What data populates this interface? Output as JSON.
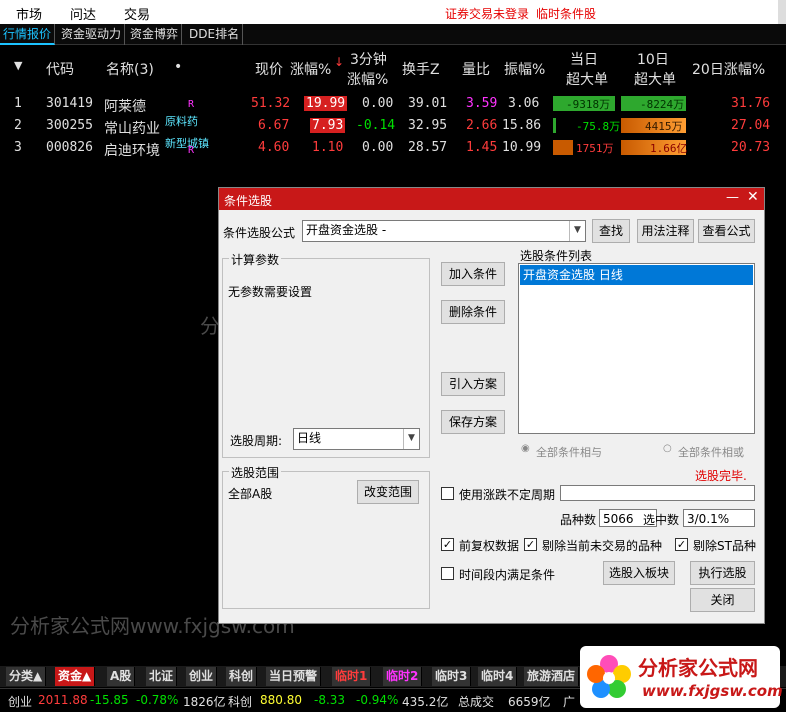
{
  "menu": {
    "items": [
      "市场",
      "问达",
      "交易"
    ],
    "alerts": [
      "证券交易未登录",
      "临时条件股"
    ]
  },
  "tabs": [
    "行情报价",
    "资金驱动力",
    "资金博弈",
    "DDE排名"
  ],
  "table": {
    "headers": {
      "code": "代码",
      "name": "名称(3)",
      "dot": "•",
      "price": "现价",
      "change": "涨幅%",
      "change3a": "3分钟",
      "change3b": "涨幅%",
      "turnover": "换手Z",
      "volratio": "量比",
      "amplitude": "振幅%",
      "bigtoday_a": "当日",
      "bigtoday_b": "超大单",
      "big10_a": "10日",
      "big10_b": "超大单",
      "change20": "20日涨幅%"
    },
    "rows": [
      {
        "idx": "1",
        "code": "301419",
        "name": "阿莱德",
        "tag": "R",
        "tag2": "",
        "price": "51.32",
        "change": "19.99",
        "change3": "0.00",
        "turnover": "39.01",
        "volratio": "3.59",
        "amplitude": "3.06",
        "bigtoday": "-9318万",
        "big10": "-8224万",
        "change20": "31.76"
      },
      {
        "idx": "2",
        "code": "300255",
        "name": "常山药业",
        "tag": "",
        "tag2": "原料药",
        "price": "6.67",
        "change": "7.93",
        "change3": "-0.14",
        "turnover": "32.95",
        "volratio": "2.66",
        "amplitude": "15.86",
        "bigtoday": "-75.8万",
        "big10": "4415万",
        "change20": "27.04"
      },
      {
        "idx": "3",
        "code": "000826",
        "name": "启迪环境",
        "tag": "R",
        "tag2": "新型城镇",
        "price": "4.60",
        "change": "1.10",
        "change3": "0.00",
        "turnover": "28.57",
        "volratio": "1.45",
        "amplitude": "10.99",
        "bigtoday": "1751万",
        "big10": "1.66亿",
        "change20": "20.73"
      }
    ]
  },
  "dialog": {
    "title": "条件选股",
    "formula_label": "条件选股公式",
    "formula_value": "开盘资金选股 -",
    "btn_find": "查找",
    "btn_usage": "用法注释",
    "btn_view": "查看公式",
    "params_title": "计算参数",
    "params_text": "无参数需要设置",
    "btn_add": "加入条件",
    "btn_delete": "删除条件",
    "btn_import": "引入方案",
    "btn_save": "保存方案",
    "cond_list_title": "选股条件列表",
    "cond_item": "开盘资金选股  日线",
    "period_label": "选股周期:",
    "period_value": "日线",
    "radio_all": "全部条件相与",
    "radio_or": "全部条件相或",
    "done_text": "选股完毕.",
    "scope_title": "选股范围",
    "scope_value": "全部A股",
    "btn_scope": "改变范围",
    "chk_uncertain": "使用涨跌不定周期",
    "count_label": "品种数",
    "count_value": "5066",
    "selected_label": "选中数",
    "selected_value": "3/0.1%",
    "chk_adjust": "前复权数据",
    "chk_exclude_notrade": "剔除当前未交易的品种",
    "chk_exclude_st": "剔除ST品种",
    "chk_timerange": "时间段内满足条件",
    "btn_toboard": "选股入板块",
    "btn_run": "执行选股",
    "btn_close": "关闭"
  },
  "bottom_tabs": [
    "分类▲",
    "资金▲",
    "A股",
    "北证",
    "创业",
    "科创",
    "当日预警",
    "临时1",
    "临时2",
    "临时3",
    "临时4",
    "旅游酒店"
  ],
  "status": {
    "items": [
      "创业",
      "2011.88",
      "-15.85",
      "-0.78%",
      "1826亿",
      "科创",
      "880.80",
      "-8.33",
      "-0.94%",
      "435.2亿",
      "总成交",
      "6659亿",
      "广"
    ]
  },
  "watermark": "分析家公式网www.fxjgsw.com",
  "logo": {
    "title": "分析家公式网",
    "url": "www.fxjgsw.com"
  }
}
